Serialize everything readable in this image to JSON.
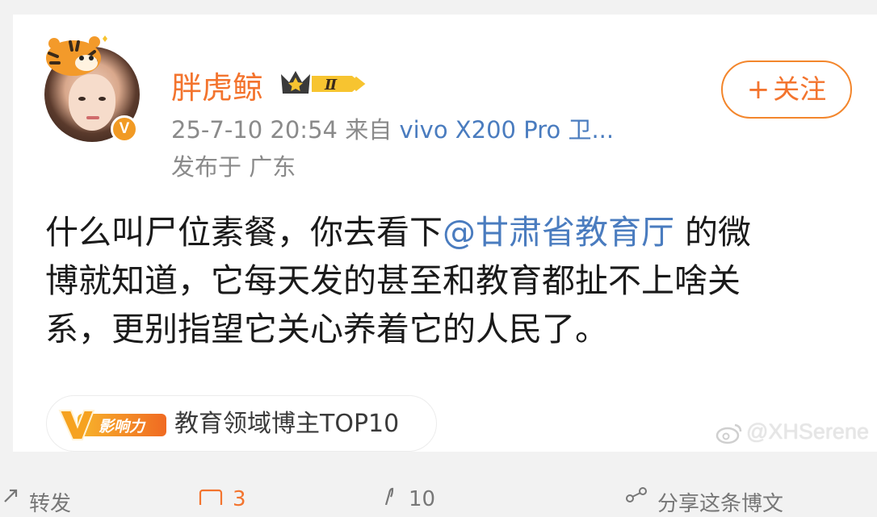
{
  "post": {
    "username": "胖虎鲸",
    "level_badge": "Ⅱ",
    "verified_mark": "V",
    "timestamp": "25-7-10 20:54",
    "source_prefix": "来自",
    "source": "vivo X200 Pro 卫...",
    "location": "发布于 广东",
    "follow_label": "关注",
    "follow_plus": "+",
    "content": {
      "line1_a": "什么叫尸位素餐，你去看下",
      "mention": "@甘肃省教育厅",
      "line1_b": " 的微",
      "line2": "博就知道，它每天发的甚至和教育都扯不上啥关",
      "line3": "系，更别指望它关心养着它的人民了。"
    },
    "influence": {
      "badge_letter": "V",
      "badge_label": "影响力",
      "label": "教育领域博主TOP10"
    },
    "watermark": "@XHSerene"
  },
  "actions": {
    "repost_label": "转发",
    "comment_count": "3",
    "like_count": "10",
    "share_label": "分享这条博文"
  },
  "colors": {
    "accent_orange": "#f3742e",
    "link_blue": "#4a7cbf",
    "meta_gray": "#8a8a8a"
  }
}
